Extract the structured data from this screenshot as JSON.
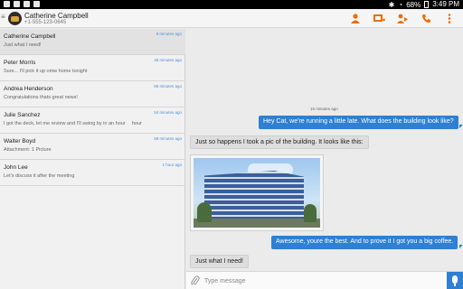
{
  "statusbar": {
    "battery": "68%",
    "time": "3:49 PM"
  },
  "header": {
    "contact_name": "Catherine Campbell",
    "contact_phone": "+1-555-123-0645",
    "actions": [
      {
        "icon": "contact-card-icon"
      },
      {
        "icon": "add-attachment-icon"
      },
      {
        "icon": "forward-icon"
      },
      {
        "icon": "phone-icon"
      },
      {
        "icon": "overflow-menu-icon"
      }
    ]
  },
  "conversations": [
    {
      "name": "Catherine Campbell",
      "time": "8 minutes ago",
      "preview": "Just what I need!",
      "selected": true
    },
    {
      "name": "Peter Morris",
      "time": "48 minutes ago",
      "preview": "Sure... I'll pick it up omw home tonight"
    },
    {
      "name": "Andrea Henderson",
      "time": "56 minutes ago",
      "preview": "Congratulations thats great news!"
    },
    {
      "name": "Julie Sanchez",
      "time": "54 minutes ago",
      "preview": "I got the deck, let me review and I'll swing by in an hour",
      "preview_extra": "hour"
    },
    {
      "name": "Walter Boyd",
      "time": "59 minutes ago",
      "preview": "Attachment: 1 Picture"
    },
    {
      "name": "John Lee",
      "time": "1 hour ago",
      "preview": "Let's discuss it after the meeting"
    }
  ],
  "chat": {
    "timestamp": "15 minutes ago",
    "messages": [
      {
        "direction": "out",
        "text": "Hey Cat, we're running a little late. What does the building look like?"
      },
      {
        "direction": "in",
        "text": "Just so happens I took a pic of the building. It looks like this:"
      },
      {
        "direction": "out",
        "text": "Awesome, youre the best. And to prove it I got you a big coffee."
      },
      {
        "direction": "in",
        "text": "Just what I need!"
      }
    ]
  },
  "compose": {
    "placeholder": "Type message"
  }
}
